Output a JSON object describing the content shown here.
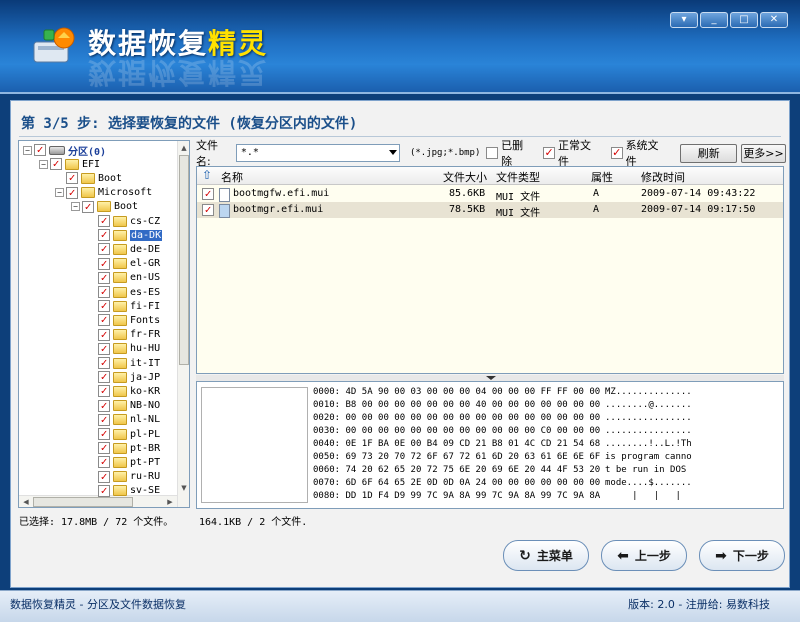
{
  "app": {
    "title_main": "数据恢复",
    "title_highlight": "精灵",
    "window_buttons": [
      "▾",
      "_",
      "□",
      "✕"
    ]
  },
  "step_title": "第 3/5 步: 选择要恢复的文件 (恢复分区内的文件)",
  "tree": {
    "nodes": [
      {
        "label": "分区(0)",
        "level": 0,
        "exp": "−",
        "type": "drive"
      },
      {
        "label": "EFI",
        "level": 1,
        "exp": "−",
        "type": "folder"
      },
      {
        "label": "Boot",
        "level": 2,
        "exp": "",
        "type": "folder"
      },
      {
        "label": "Microsoft",
        "level": 2,
        "exp": "−",
        "type": "folder"
      },
      {
        "label": "Boot",
        "level": 3,
        "exp": "−",
        "type": "folder"
      },
      {
        "label": "cs-CZ",
        "level": 4,
        "exp": "",
        "type": "folder"
      },
      {
        "label": "da-DK",
        "level": 4,
        "exp": "",
        "type": "folder",
        "selected": true
      },
      {
        "label": "de-DE",
        "level": 4,
        "exp": "",
        "type": "folder"
      },
      {
        "label": "el-GR",
        "level": 4,
        "exp": "",
        "type": "folder"
      },
      {
        "label": "en-US",
        "level": 4,
        "exp": "",
        "type": "folder"
      },
      {
        "label": "es-ES",
        "level": 4,
        "exp": "",
        "type": "folder"
      },
      {
        "label": "fi-FI",
        "level": 4,
        "exp": "",
        "type": "folder"
      },
      {
        "label": "Fonts",
        "level": 4,
        "exp": "",
        "type": "folder"
      },
      {
        "label": "fr-FR",
        "level": 4,
        "exp": "",
        "type": "folder"
      },
      {
        "label": "hu-HU",
        "level": 4,
        "exp": "",
        "type": "folder"
      },
      {
        "label": "it-IT",
        "level": 4,
        "exp": "",
        "type": "folder"
      },
      {
        "label": "ja-JP",
        "level": 4,
        "exp": "",
        "type": "folder"
      },
      {
        "label": "ko-KR",
        "level": 4,
        "exp": "",
        "type": "folder"
      },
      {
        "label": "NB-NO",
        "level": 4,
        "exp": "",
        "type": "folder"
      },
      {
        "label": "nl-NL",
        "level": 4,
        "exp": "",
        "type": "folder"
      },
      {
        "label": "pl-PL",
        "level": 4,
        "exp": "",
        "type": "folder"
      },
      {
        "label": "pt-BR",
        "level": 4,
        "exp": "",
        "type": "folder"
      },
      {
        "label": "pt-PT",
        "level": 4,
        "exp": "",
        "type": "folder"
      },
      {
        "label": "ru-RU",
        "level": 4,
        "exp": "",
        "type": "folder"
      },
      {
        "label": "sv-SE",
        "level": 4,
        "exp": "",
        "type": "folder"
      }
    ]
  },
  "filter": {
    "filename_label": "文件名:",
    "filename_value": "*.*",
    "hint": "(*.jpg;*.bmp)",
    "deleted_label": "已删除",
    "deleted_checked": false,
    "normal_label": "正常文件",
    "normal_checked": true,
    "system_label": "系统文件",
    "system_checked": true,
    "refresh_label": "刷新",
    "more_label": "更多>>"
  },
  "filelist": {
    "columns": {
      "name": "名称",
      "size": "文件大小",
      "type": "文件类型",
      "attr": "属性",
      "modified": "修改时间"
    },
    "rows": [
      {
        "name": "bootmgfw.efi.mui",
        "size": "85.6KB",
        "type": "MUI 文件",
        "attr": "A",
        "modified": "2009-07-14 09:43:22"
      },
      {
        "name": "bootmgr.efi.mui",
        "size": "78.5KB",
        "type": "MUI 文件",
        "attr": "A",
        "modified": "2009-07-14 09:17:50"
      }
    ]
  },
  "hex": {
    "lines": [
      {
        "off": "0000:",
        "bytes": "4D 5A 90 00 03 00 00 00 04 00 00 00 FF FF 00 00",
        "ascii": "MZ.............."
      },
      {
        "off": "0010:",
        "bytes": "B8 00 00 00 00 00 00 00 40 00 00 00 00 00 00 00",
        "ascii": "........@......."
      },
      {
        "off": "0020:",
        "bytes": "00 00 00 00 00 00 00 00 00 00 00 00 00 00 00 00",
        "ascii": "................"
      },
      {
        "off": "0030:",
        "bytes": "00 00 00 00 00 00 00 00 00 00 00 00 C0 00 00 00",
        "ascii": "................"
      },
      {
        "off": "0040:",
        "bytes": "0E 1F BA 0E 00 B4 09 CD 21 B8 01 4C CD 21 54 68",
        "ascii": "........!..L.!Th"
      },
      {
        "off": "0050:",
        "bytes": "69 73 20 70 72 6F 67 72 61 6D 20 63 61 6E 6E 6F",
        "ascii": "is program canno"
      },
      {
        "off": "0060:",
        "bytes": "74 20 62 65 20 72 75 6E 20 69 6E 20 44 4F 53 20",
        "ascii": "t be run in DOS "
      },
      {
        "off": "0070:",
        "bytes": "6D 6F 64 65 2E 0D 0D 0A 24 00 00 00 00 00 00 00",
        "ascii": "mode....$......."
      },
      {
        "off": "0080:",
        "bytes": "DD 1D F4 D9 99 7C 9A 8A 99 7C 9A 8A 99 7C 9A 8A",
        "ascii": "     |   |   |  "
      }
    ]
  },
  "status": {
    "selected": "已选择: 17.8MB / 72 个文件。",
    "listinfo": "164.1KB / 2 个文件."
  },
  "nav": {
    "main_menu": "主菜单",
    "prev": "上一步",
    "next": "下一步"
  },
  "footer": {
    "left": "数据恢复精灵 - 分区及文件数据恢复",
    "right": "版本: 2.0 - 注册给: 易数科技"
  }
}
